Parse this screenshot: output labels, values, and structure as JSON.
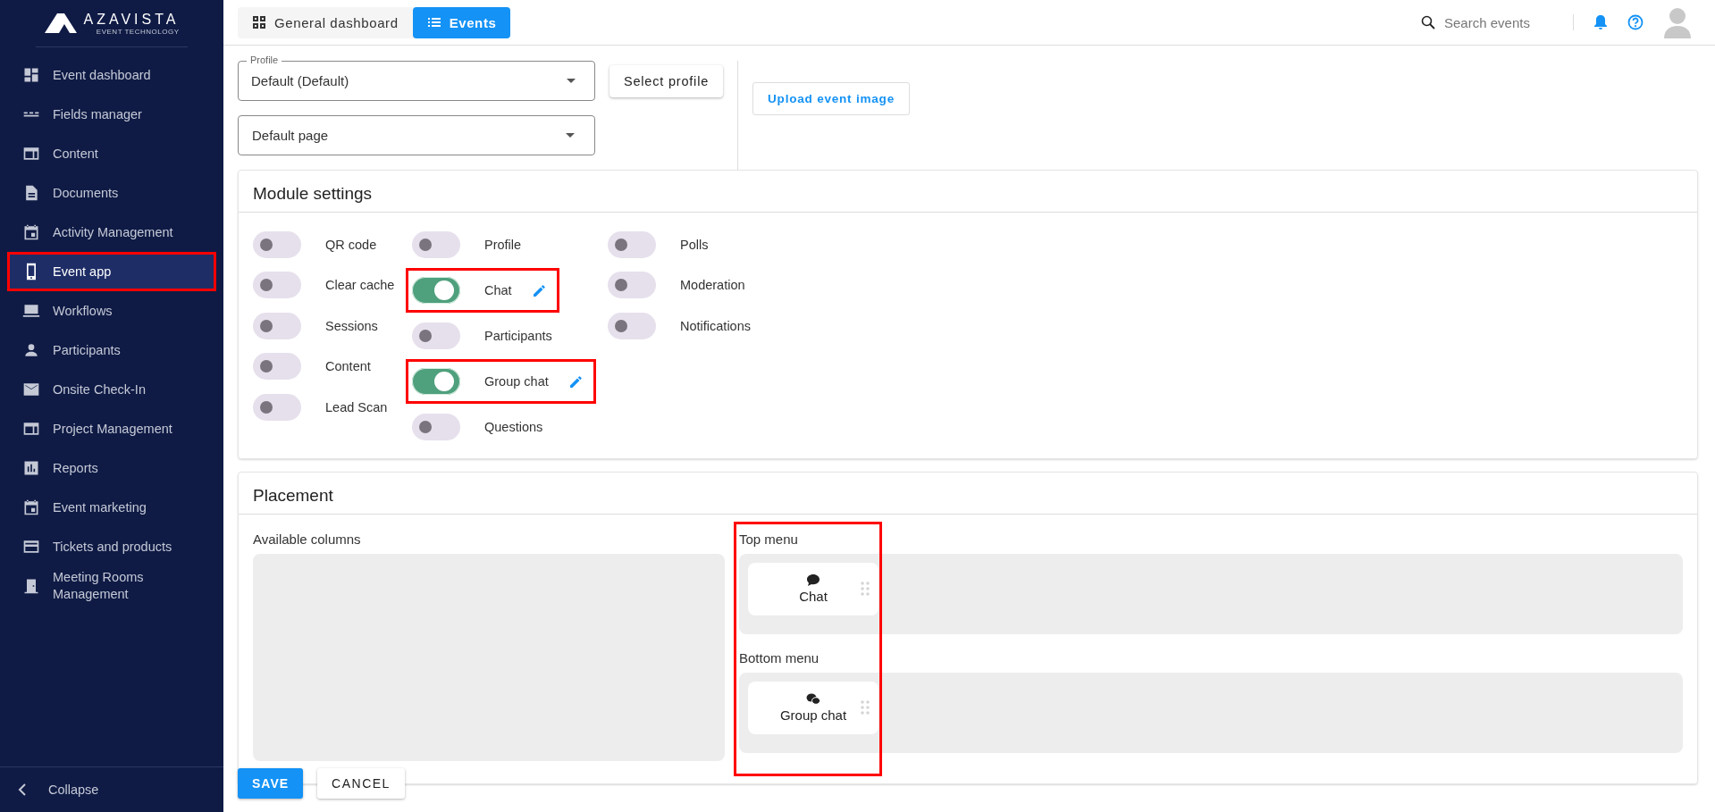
{
  "sidebar": {
    "logo": {
      "name": "AZAVISTA",
      "tagline": "EVENT TECHNOLOGY"
    },
    "items": [
      {
        "label": "Event dashboard",
        "selected": false,
        "highlighted": false
      },
      {
        "label": "Fields manager",
        "selected": false,
        "highlighted": false
      },
      {
        "label": "Content",
        "selected": false,
        "highlighted": false
      },
      {
        "label": "Documents",
        "selected": false,
        "highlighted": false
      },
      {
        "label": "Activity Management",
        "selected": false,
        "highlighted": false
      },
      {
        "label": "Event app",
        "selected": true,
        "highlighted": true
      },
      {
        "label": "Workflows",
        "selected": false,
        "highlighted": false
      },
      {
        "label": "Participants",
        "selected": false,
        "highlighted": false
      },
      {
        "label": "Onsite Check-In",
        "selected": false,
        "highlighted": false
      },
      {
        "label": "Project Management",
        "selected": false,
        "highlighted": false
      },
      {
        "label": "Reports",
        "selected": false,
        "highlighted": false
      },
      {
        "label": "Event marketing",
        "selected": false,
        "highlighted": false
      },
      {
        "label": "Tickets and products",
        "selected": false,
        "highlighted": false
      },
      {
        "label": "Meeting Rooms Management",
        "selected": false,
        "highlighted": false
      }
    ],
    "collapse": {
      "label": "Collapse"
    }
  },
  "topbar": {
    "tabs": [
      {
        "label": "General dashboard",
        "selected": false
      },
      {
        "label": "Events",
        "selected": true
      }
    ],
    "search": {
      "placeholder": "Search events"
    }
  },
  "profile": {
    "field": {
      "label": "Profile",
      "value": "Default (Default)"
    },
    "page_field": {
      "label": "Default page"
    },
    "select_button": "Select profile",
    "upload_button": "Upload event image"
  },
  "module_settings": {
    "title": "Module settings",
    "columns": [
      [
        {
          "label": "QR code",
          "on": false,
          "highlighted": false
        },
        {
          "label": "Clear cache",
          "on": false,
          "highlighted": false
        },
        {
          "label": "Sessions",
          "on": false,
          "highlighted": false
        },
        {
          "label": "Content",
          "on": false,
          "highlighted": false
        },
        {
          "label": "Lead Scan",
          "on": false,
          "highlighted": false
        }
      ],
      [
        {
          "label": "Profile",
          "on": false,
          "highlighted": false
        },
        {
          "label": "Chat",
          "on": true,
          "highlighted": true
        },
        {
          "label": "Participants",
          "on": false,
          "highlighted": false
        },
        {
          "label": "Group chat",
          "on": true,
          "highlighted": true
        },
        {
          "label": "Questions",
          "on": false,
          "highlighted": false
        }
      ],
      [
        {
          "label": "Polls",
          "on": false,
          "highlighted": false
        },
        {
          "label": "Moderation",
          "on": false,
          "highlighted": false
        },
        {
          "label": "Notifications",
          "on": false,
          "highlighted": false
        }
      ]
    ]
  },
  "placement": {
    "title": "Placement",
    "available": {
      "label": "Available columns"
    },
    "highlighted": true,
    "menus": [
      {
        "label": "Top menu",
        "items": [
          {
            "label": "Chat",
            "kind": "chat"
          }
        ]
      },
      {
        "label": "Bottom menu",
        "items": [
          {
            "label": "Group chat",
            "kind": "group_chat"
          }
        ]
      }
    ]
  },
  "actions": {
    "save": "SAVE",
    "cancel": "CANCEL"
  }
}
